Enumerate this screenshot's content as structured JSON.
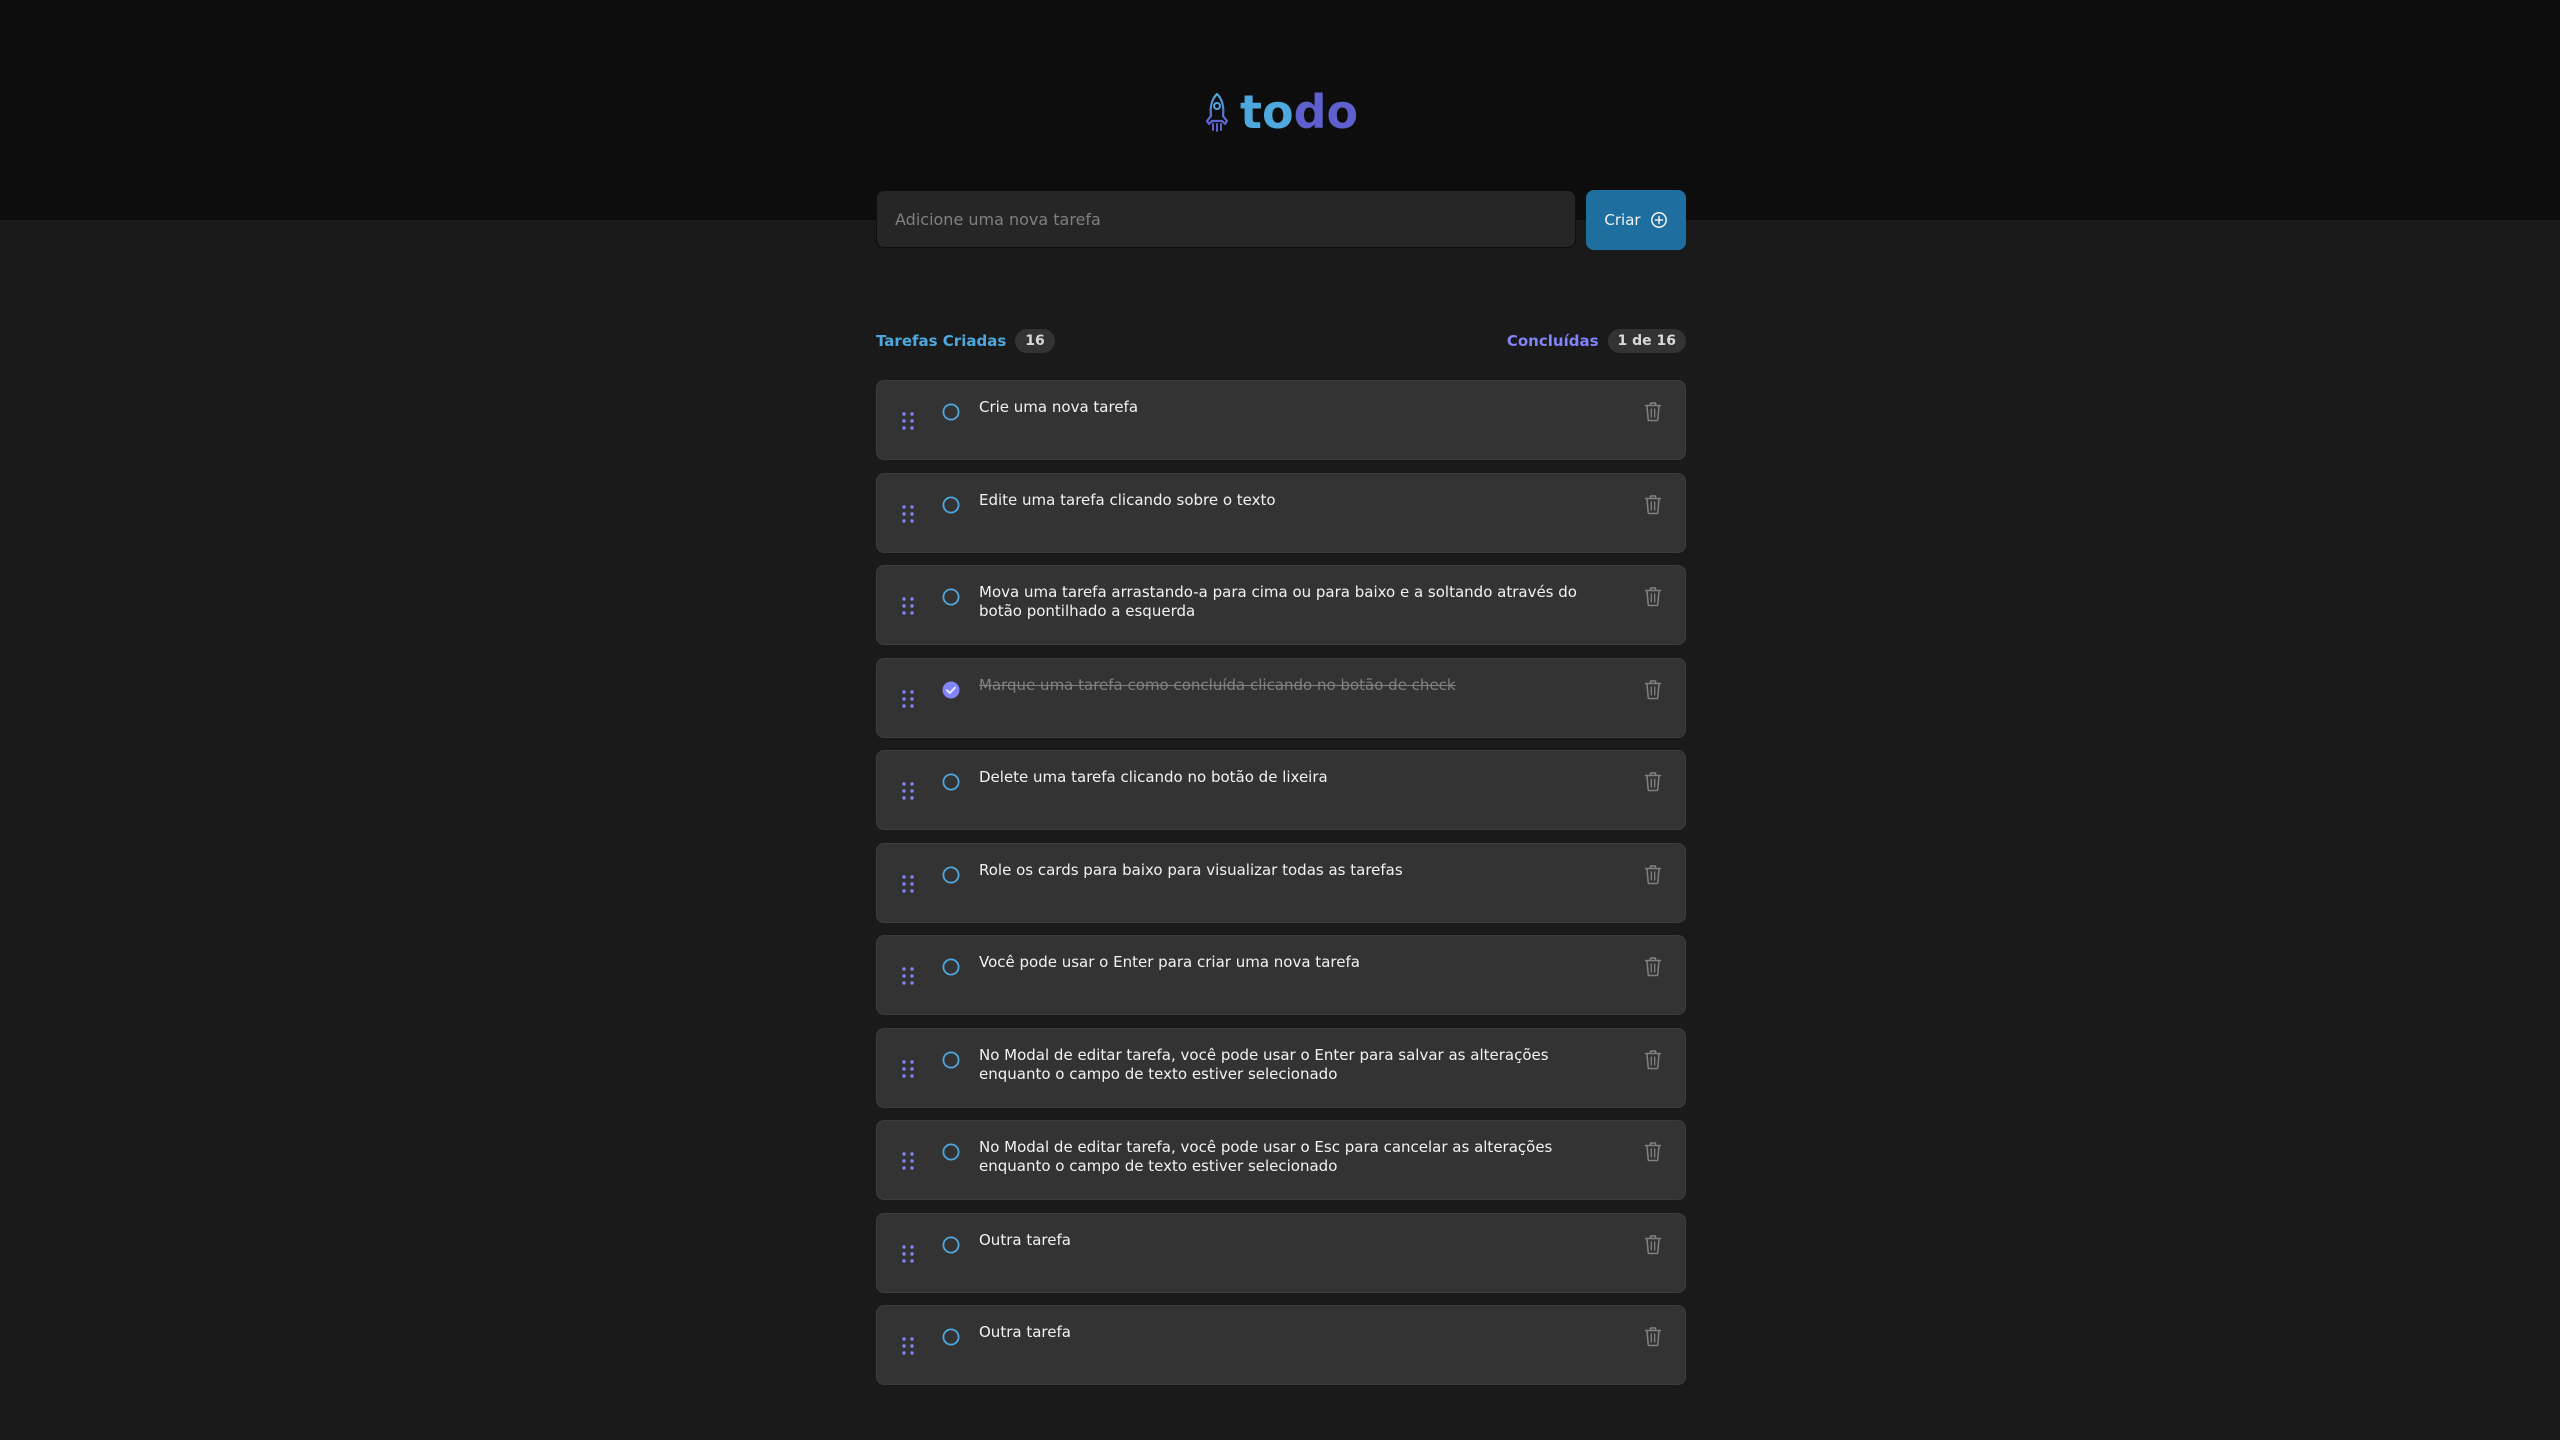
{
  "header": {
    "logo_part1": "to",
    "logo_part2": "do",
    "logo_icon": "rocket-icon"
  },
  "new_task": {
    "placeholder": "Adicione uma nova tarefa",
    "value": "",
    "create_label": "Criar",
    "create_icon": "plus-circle-icon"
  },
  "counters": {
    "created_label": "Tarefas Criadas",
    "created_count": "16",
    "done_label": "Concluídas",
    "done_count": "1 de 16"
  },
  "colors": {
    "brand_blue": "#4ea8de",
    "brand_purple": "#5e60ce",
    "button_blue": "#1e6f9f",
    "card_bg": "#333333",
    "page_bg": "#1a1a1a",
    "header_bg": "#0d0d0d"
  },
  "tasks": [
    {
      "text": "Crie uma nova tarefa",
      "done": false
    },
    {
      "text": "Edite uma tarefa clicando sobre o texto",
      "done": false
    },
    {
      "text": "Mova uma tarefa arrastando-a para cima ou para baixo e a soltando através do botão pontilhado a esquerda",
      "done": false
    },
    {
      "text": "Marque uma tarefa como concluída clicando no botão de check",
      "done": true
    },
    {
      "text": "Delete uma tarefa clicando no botão de lixeira",
      "done": false
    },
    {
      "text": "Role os cards para baixo para visualizar todas as tarefas",
      "done": false
    },
    {
      "text": "Você pode usar o Enter para criar uma nova tarefa",
      "done": false
    },
    {
      "text": "No Modal de editar tarefa, você pode usar o Enter para salvar as alterações enquanto o campo de texto estiver selecionado",
      "done": false
    },
    {
      "text": "No Modal de editar tarefa, você pode usar o Esc para cancelar as alterações enquanto o campo de texto estiver selecionado",
      "done": false
    },
    {
      "text": "Outra tarefa",
      "done": false
    },
    {
      "text": "Outra tarefa",
      "done": false
    }
  ]
}
